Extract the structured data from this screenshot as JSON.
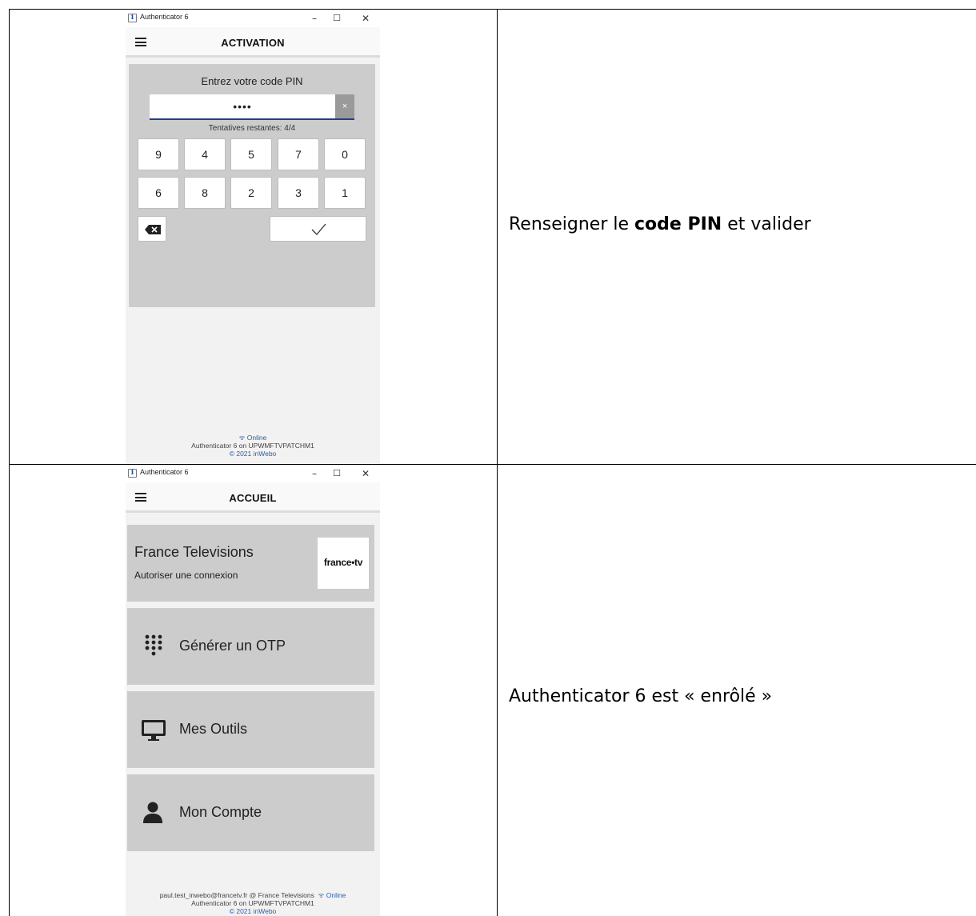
{
  "rows": [
    {
      "caption_prefix": "Renseigner le ",
      "caption_bold": "code PIN",
      "caption_suffix": " et valider",
      "window": {
        "title": "Authenticator 6",
        "app_icon": "i",
        "controls": {
          "minimize": "–",
          "maximize": "☐",
          "close": "✕"
        },
        "appbar_title": "ACTIVATION",
        "pin_prompt": "Entrez votre code PIN",
        "pin_value": "••••",
        "pin_clear": "×",
        "attempts": "Tentatives restantes: 4/4",
        "keypad_row1": [
          "9",
          "4",
          "5",
          "7",
          "0"
        ],
        "keypad_row2": [
          "6",
          "8",
          "2",
          "3",
          "1"
        ],
        "footer_status": "Online",
        "footer_device": "Authenticator 6 on UPWMFTVPATCHM1",
        "footer_copyright": "© 2021 inWebo"
      }
    },
    {
      "caption": "Authenticator 6 est « enrôlé »",
      "window": {
        "title": "Authenticator 6",
        "app_icon": "i",
        "controls": {
          "minimize": "–",
          "maximize": "☐",
          "close": "✕"
        },
        "appbar_title": "ACCUEIL",
        "service_title": "France Televisions",
        "service_sub": "Autoriser une connexion",
        "service_logo": "france•tv",
        "menu": [
          "Générer un OTP",
          "Mes Outils",
          "Mon Compte"
        ],
        "footer_user": "paul.test_inwebo@francetv.fr @ France Televisions",
        "footer_status": "Online",
        "footer_device": "Authenticator 6 on UPWMFTVPATCHM1",
        "footer_copyright": "© 2021 inWebo"
      }
    }
  ]
}
